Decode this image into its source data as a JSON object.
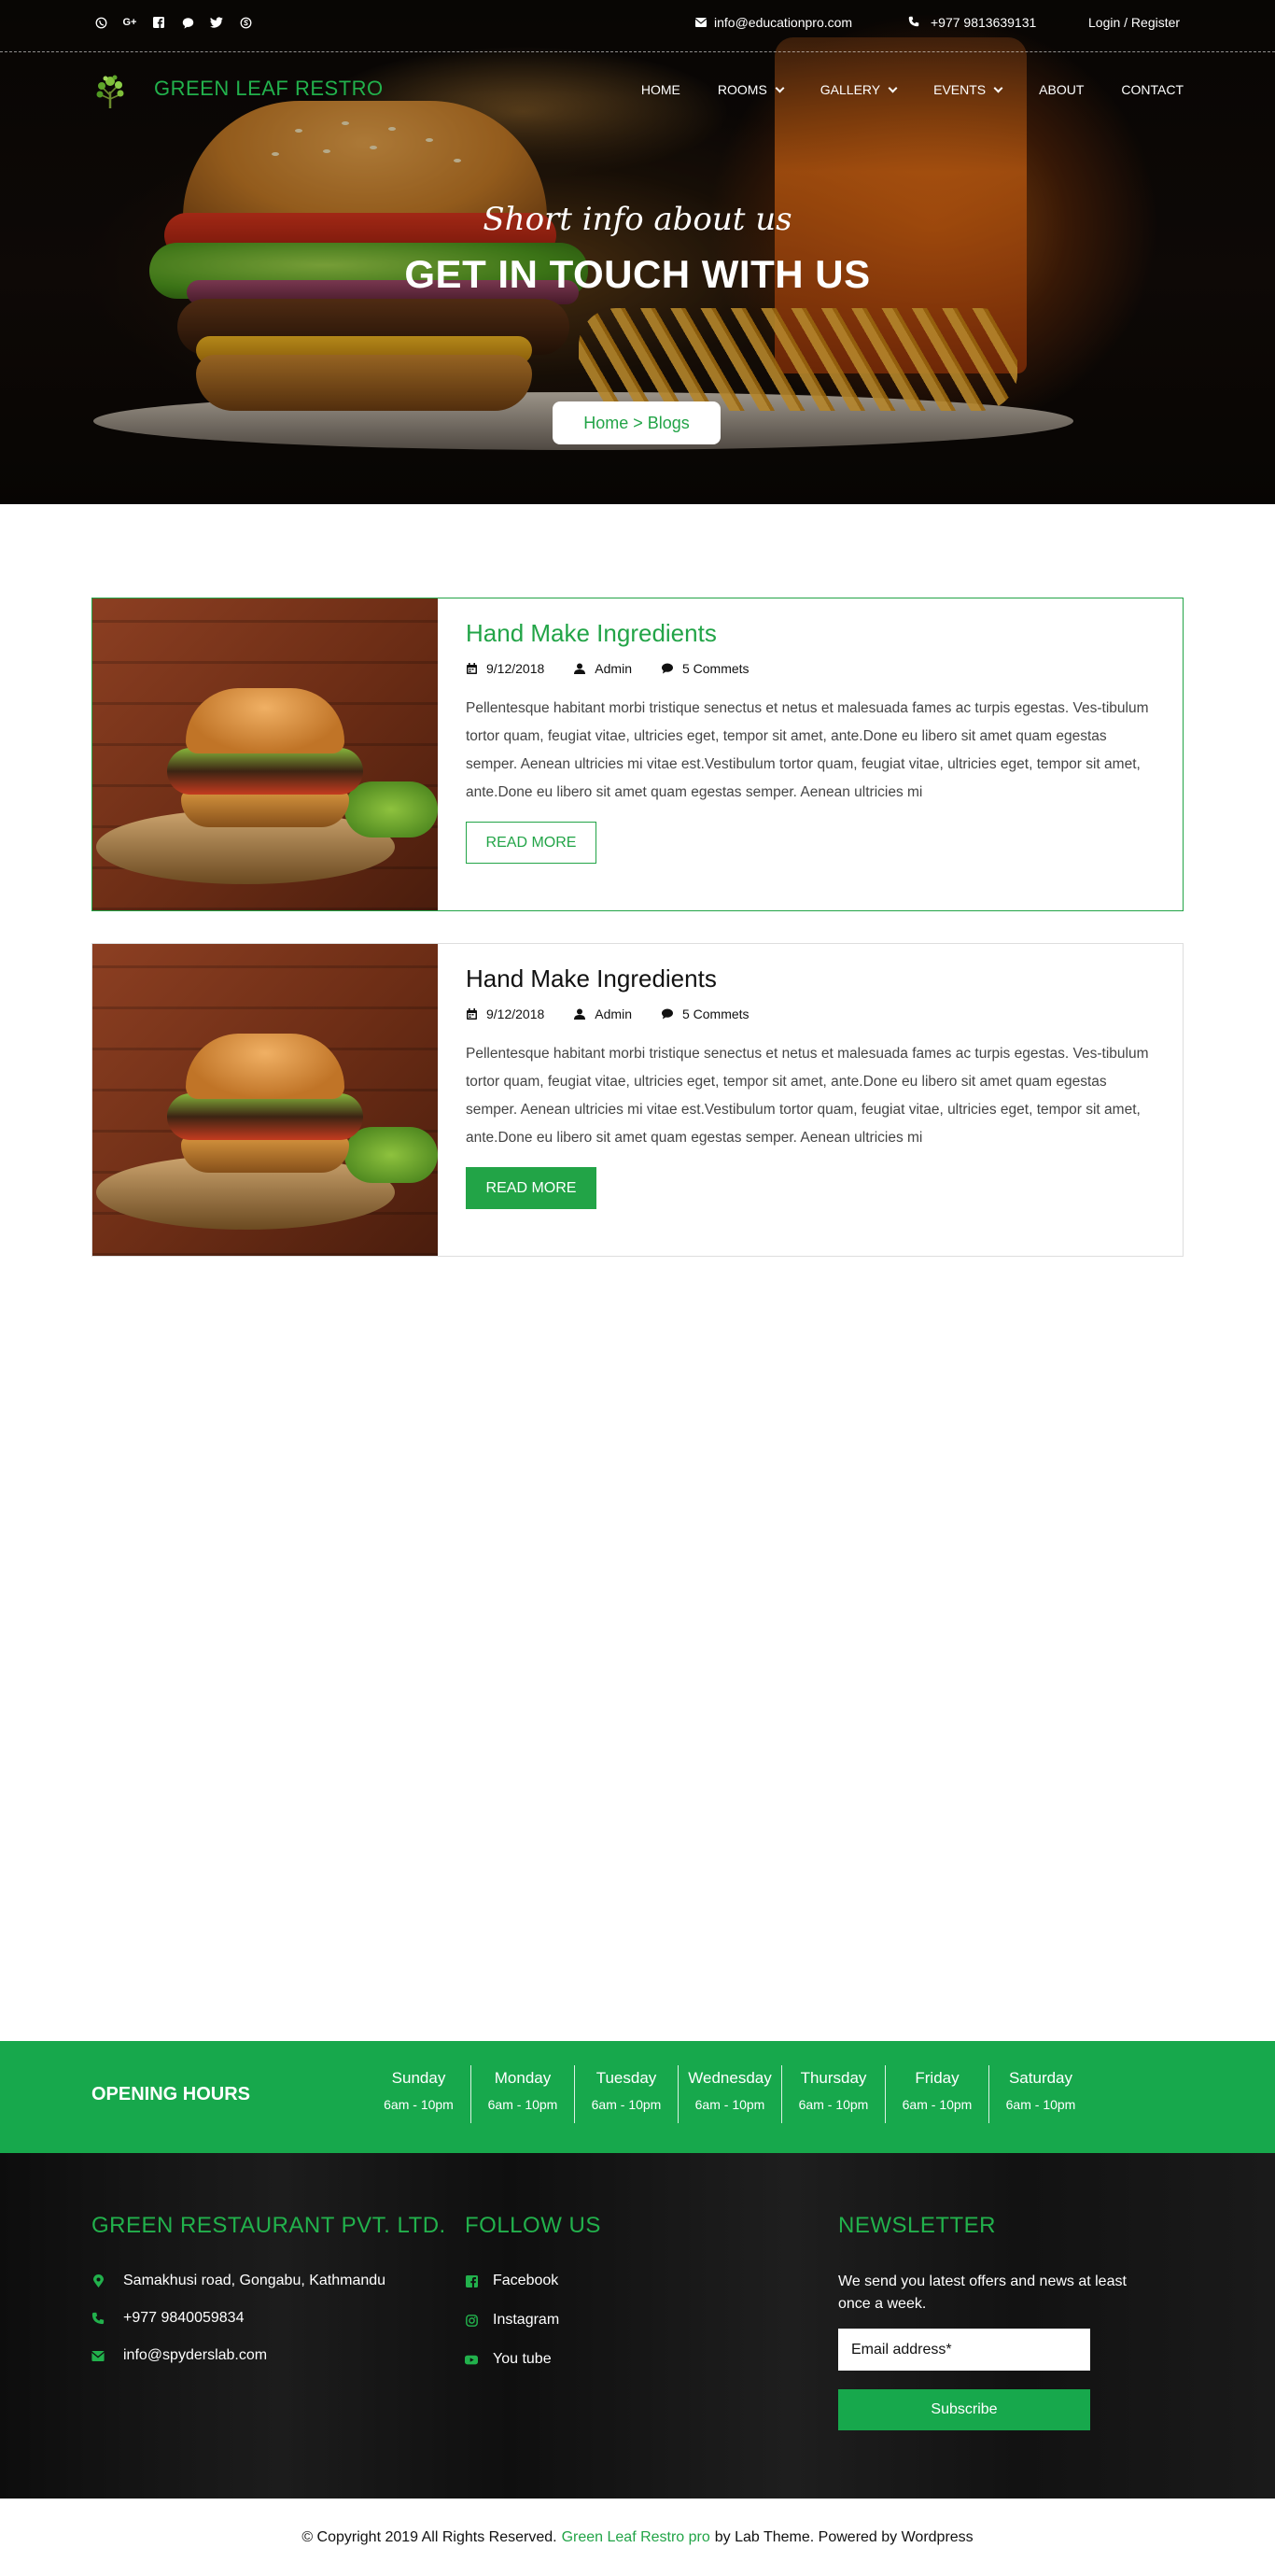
{
  "topbar": {
    "social_icons": [
      "viber-icon",
      "google-plus-icon",
      "facebook-icon",
      "messenger-icon",
      "twitter-icon",
      "skype-icon"
    ],
    "email": "info@educationpro.com",
    "phone": "+977 9813639131",
    "login": "Login / Register"
  },
  "brand": {
    "name": "GREEN LEAF RESTRO",
    "accent": "#22b14c"
  },
  "nav": {
    "items": [
      {
        "label": "HOME",
        "dropdown": false
      },
      {
        "label": "ROOMS",
        "dropdown": true
      },
      {
        "label": "GALLERY",
        "dropdown": true
      },
      {
        "label": "EVENTS",
        "dropdown": true
      },
      {
        "label": "ABOUT",
        "dropdown": false
      },
      {
        "label": "CONTACT",
        "dropdown": false
      }
    ]
  },
  "hero": {
    "subtitle": "Short info about us",
    "title": "GET IN TOUCH WITH US",
    "breadcrumb": "Home > Blogs"
  },
  "posts": [
    {
      "title": "Hand Make Ingredients",
      "date": "9/12/2018",
      "author": "Admin",
      "comments": "5 Commets",
      "excerpt": "Pellentesque habitant morbi tristique senectus et netus et malesuada fames ac turpis egestas. Ves-tibulum tortor quam, feugiat vitae, ultricies eget, tempor sit amet, ante.Done eu libero sit amet quam egestas semper. Aenean ultricies mi vitae est.Vestibulum tortor quam, feugiat vitae, ultricies eget, tempor sit amet, ante.Done eu libero sit amet quam egestas semper. Aenean ultricies mi",
      "button": "READ MORE"
    },
    {
      "title": "Hand Make Ingredients",
      "date": "9/12/2018",
      "author": "Admin",
      "comments": "5 Commets",
      "excerpt": "Pellentesque habitant morbi tristique senectus et netus et malesuada fames ac turpis egestas. Ves-tibulum tortor quam, feugiat vitae, ultricies eget, tempor sit amet, ante.Done eu libero sit amet quam egestas semper. Aenean ultricies mi vitae est.Vestibulum tortor quam, feugiat vitae, ultricies eget, tempor sit amet, ante.Done eu libero sit amet quam egestas semper. Aenean ultricies mi",
      "button": "READ MORE"
    }
  ],
  "hours": {
    "title": "OPENING HOURS",
    "days": [
      {
        "day": "Sunday",
        "time": "6am - 10pm"
      },
      {
        "day": "Monday",
        "time": "6am - 10pm"
      },
      {
        "day": "Tuesday",
        "time": "6am - 10pm"
      },
      {
        "day": "Wednesday",
        "time": "6am - 10pm"
      },
      {
        "day": "Thursday",
        "time": "6am - 10pm"
      },
      {
        "day": "Friday",
        "time": "6am - 10pm"
      },
      {
        "day": "Saturday",
        "time": "6am - 10pm"
      }
    ],
    "color": "#17a84c"
  },
  "footer": {
    "company": {
      "title": "GREEN RESTAURANT PVT. LTD.",
      "address": "Samakhusi road, Gongabu, Kathmandu",
      "phone": "+977 9840059834",
      "email": "info@spyderslab.com"
    },
    "follow": {
      "title": "FOLLOW US",
      "links": [
        "Facebook",
        "Instagram",
        "You tube"
      ]
    },
    "newsletter": {
      "title": "NEWSLETTER",
      "text": "We send you latest offers and news at least once a week.",
      "placeholder": "Email address*",
      "button": "Subscribe"
    }
  },
  "copyright": {
    "prefix": "© Copyright 2019 All Rights Reserved.",
    "brand": "Green Leaf Restro pro",
    "suffix": "by Lab Theme. Powered by Wordpress"
  }
}
